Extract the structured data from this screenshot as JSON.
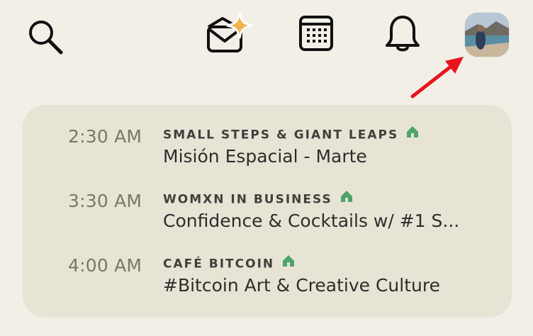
{
  "top_bar": {
    "icons": [
      {
        "name": "search-icon"
      },
      {
        "name": "invite-envelope-sparkle-icon"
      },
      {
        "name": "calendar-icon"
      },
      {
        "name": "bell-icon"
      },
      {
        "name": "avatar"
      }
    ]
  },
  "events": [
    {
      "time": "2:30 AM",
      "club": "SMALL STEPS & GIANT LEAPS",
      "title": "Misión Espacial - Marte"
    },
    {
      "time": "3:30 AM",
      "club": "WOMXN IN BUSINESS",
      "title": "Confidence & Cocktails w/ #1 S..."
    },
    {
      "time": "4:00 AM",
      "club": "CAFÉ BITCOIN",
      "title": " #Bitcoin Art & Creative Culture"
    }
  ],
  "colors": {
    "background": "#f2efe6",
    "card": "#e7e4d6",
    "time_text": "#7a7864",
    "club_text": "#3f3f3b",
    "title_text": "#2d2d2a",
    "house_green": "#4fa36b",
    "annotation_arrow": "#e8141b"
  }
}
